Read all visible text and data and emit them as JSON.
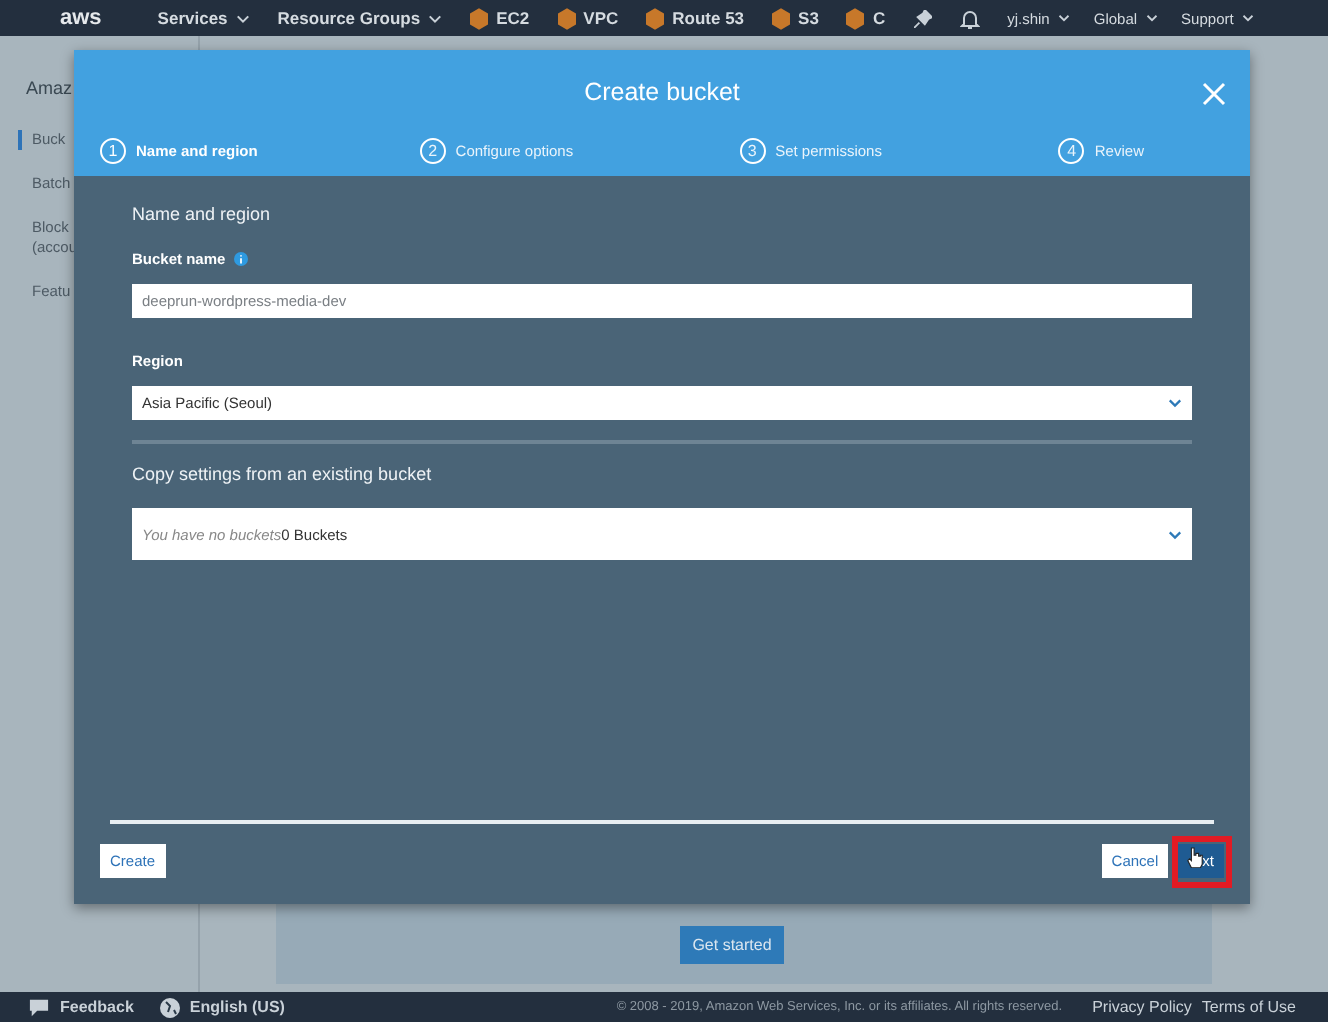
{
  "nav": {
    "logo": "aws",
    "menus": [
      "Services",
      "Resource Groups"
    ],
    "shortcuts": [
      "EC2",
      "VPC",
      "Route 53",
      "S3",
      "C"
    ],
    "account": [
      "yj.shin",
      "Global",
      "Support"
    ]
  },
  "sidebar": {
    "title": "Amaz",
    "items": [
      {
        "lines": [
          "Buck"
        ],
        "selected": true
      },
      {
        "lines": [
          "Batch"
        ],
        "selected": false
      },
      {
        "lines": [
          "Block",
          "(accou"
        ],
        "selected": false
      },
      {
        "lines": [
          "Featu"
        ],
        "selected": false
      }
    ]
  },
  "page": {
    "get_started": "Get started"
  },
  "modal": {
    "title": "Create bucket",
    "steps": [
      {
        "number": "1",
        "label": "Name and region",
        "selected": true
      },
      {
        "number": "2",
        "label": "Configure options",
        "selected": false
      },
      {
        "number": "3",
        "label": "Set permissions",
        "selected": false
      },
      {
        "number": "4",
        "label": "Review",
        "selected": false
      }
    ],
    "section_title": "Name and region",
    "bucket_name": {
      "label": "Bucket name",
      "placeholder": "deeprun-wordpress-media-dev"
    },
    "region": {
      "label": "Region",
      "value": "Asia Pacific (Seoul)"
    },
    "copy_settings": {
      "label": "Copy settings from an existing bucket",
      "placeholder": "You have no buckets",
      "value": "0 Buckets"
    },
    "buttons": {
      "create": "Create",
      "cancel": "Cancel",
      "next": "xt"
    },
    "next_highlighted": true
  },
  "footer": {
    "feedback": "Feedback",
    "language": "English (US)",
    "copyright": "© 2008 - 2019, Amazon Web Services, Inc. or its affiliates. All rights reserved.",
    "links": [
      "Privacy Policy",
      "Terms of Use"
    ]
  }
}
